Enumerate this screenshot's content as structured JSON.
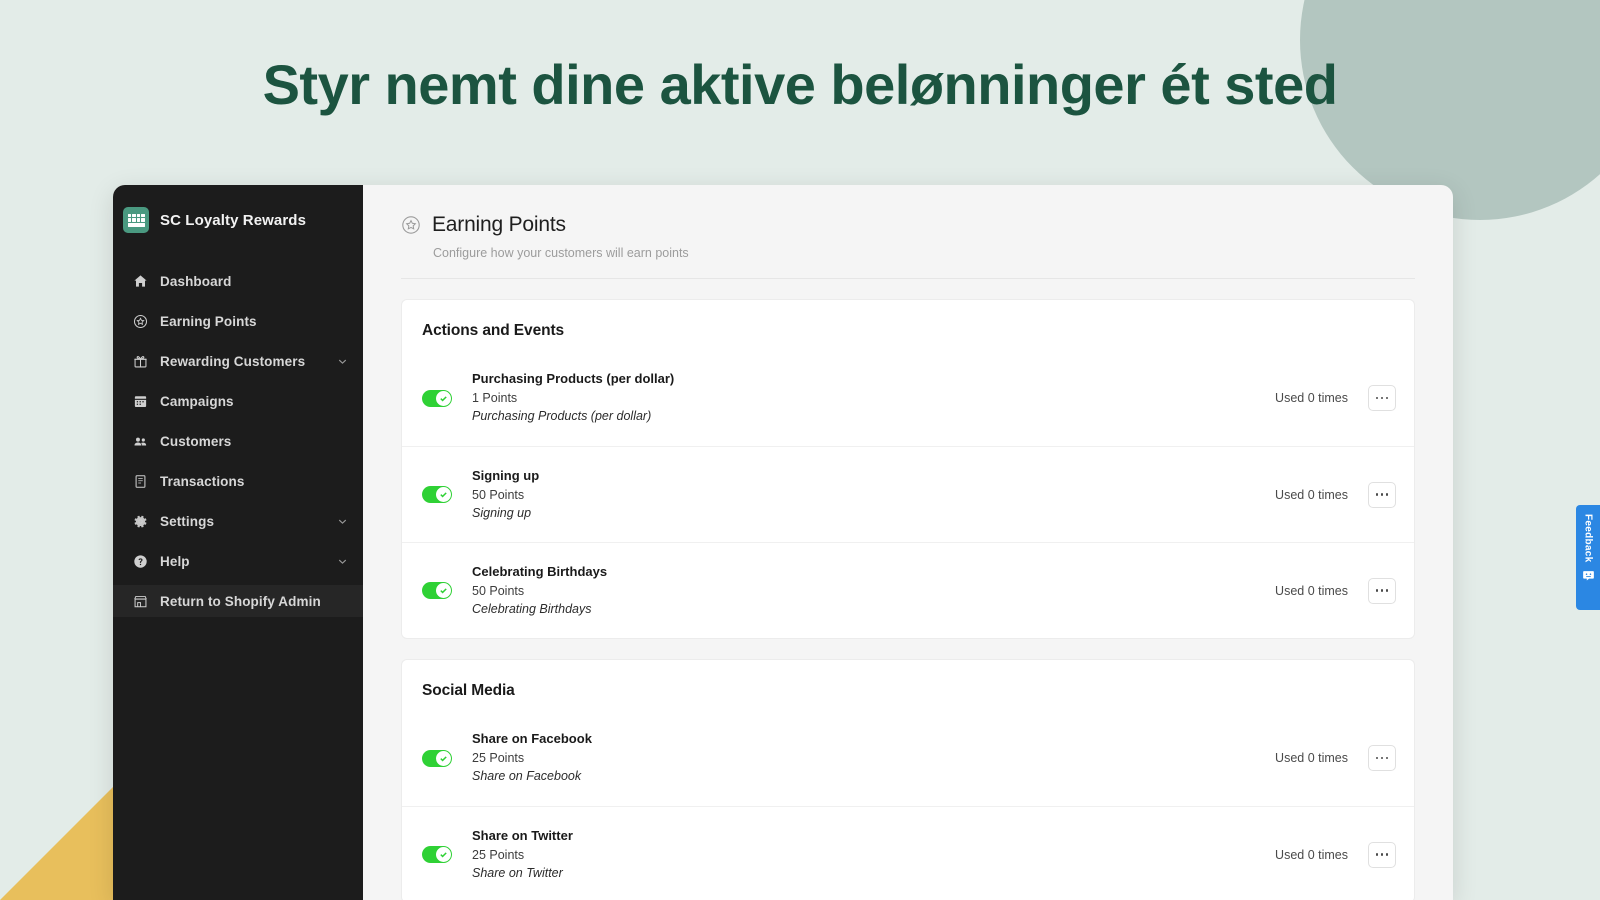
{
  "headline": "Styr nemt dine aktive belønninger ét sted",
  "theme": {
    "page_background": "#e3ece8",
    "accent_green": "#1c5440",
    "circle_color": "#b3c6c0",
    "triangle_color": "#e8bf5c",
    "sidebar_background": "#1c1c1c",
    "toggle_on_color": "#2fd135",
    "feedback_blue": "#2b87e3",
    "brand_logo_color": "#4a9980"
  },
  "sidebar": {
    "brand": {
      "name": "SC Loyalty Rewards",
      "logo_icon": "calculator-grid-icon"
    },
    "items": [
      {
        "label": "Dashboard",
        "icon": "home-icon",
        "chevron": false,
        "highlight": false
      },
      {
        "label": "Earning Points",
        "icon": "star-circle-icon",
        "chevron": false,
        "highlight": false
      },
      {
        "label": "Rewarding Customers",
        "icon": "gift-icon",
        "chevron": true,
        "highlight": false
      },
      {
        "label": "Campaigns",
        "icon": "calendar-icon",
        "chevron": false,
        "highlight": false
      },
      {
        "label": "Customers",
        "icon": "people-icon",
        "chevron": false,
        "highlight": false
      },
      {
        "label": "Transactions",
        "icon": "receipt-icon",
        "chevron": false,
        "highlight": false
      },
      {
        "label": "Settings",
        "icon": "gear-icon",
        "chevron": true,
        "highlight": false
      },
      {
        "label": "Help",
        "icon": "question-circle-icon",
        "chevron": true,
        "highlight": false
      },
      {
        "label": "Return to Shopify Admin",
        "icon": "store-icon",
        "chevron": false,
        "highlight": true
      }
    ]
  },
  "page": {
    "title": "Earning Points",
    "title_icon": "star-circle-icon",
    "subtitle": "Configure how your customers will earn points"
  },
  "cards": [
    {
      "title": "Actions and Events",
      "rows": [
        {
          "name": "Purchasing Products (per dollar)",
          "points": "1 Points",
          "description": "Purchasing Products (per dollar)",
          "used": "Used 0 times",
          "enabled": true
        },
        {
          "name": "Signing up",
          "points": "50 Points",
          "description": "Signing up",
          "used": "Used 0 times",
          "enabled": true
        },
        {
          "name": "Celebrating Birthdays",
          "points": "50 Points",
          "description": "Celebrating Birthdays",
          "used": "Used 0 times",
          "enabled": true
        }
      ]
    },
    {
      "title": "Social Media",
      "rows": [
        {
          "name": "Share on Facebook",
          "points": "25 Points",
          "description": "Share on Facebook",
          "used": "Used 0 times",
          "enabled": true
        },
        {
          "name": "Share on Twitter",
          "points": "25 Points",
          "description": "Share on Twitter",
          "used": "Used 0 times",
          "enabled": true
        }
      ]
    }
  ],
  "feedback": {
    "label": "Feedback",
    "icon": "smiley-chat-icon"
  }
}
